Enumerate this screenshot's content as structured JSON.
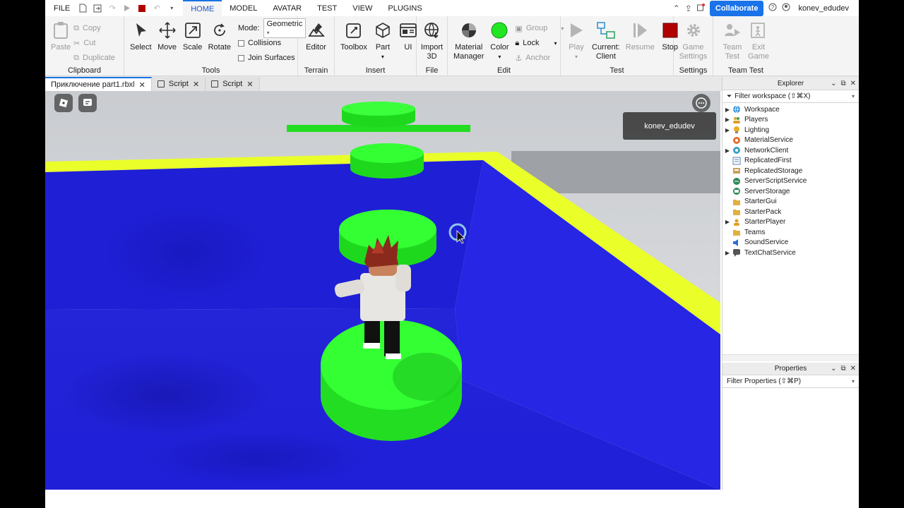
{
  "menubar": {
    "file": "FILE",
    "tabs": [
      "HOME",
      "MODEL",
      "AVATAR",
      "TEST",
      "VIEW",
      "PLUGINS"
    ],
    "collaborate": "Collaborate",
    "username": "konev_edudev"
  },
  "ribbon": {
    "clipboard": {
      "label": "Clipboard",
      "paste": "Paste",
      "copy": "Copy",
      "cut": "Cut",
      "duplicate": "Duplicate"
    },
    "tools": {
      "label": "Tools",
      "select": "Select",
      "move": "Move",
      "scale": "Scale",
      "rotate": "Rotate",
      "mode_label": "Mode:",
      "mode_value": "Geometric",
      "collisions": "Collisions",
      "join_surfaces": "Join Surfaces"
    },
    "terrain": {
      "label": "Terrain",
      "editor": "Editor"
    },
    "insert": {
      "label": "Insert",
      "toolbox": "Toolbox",
      "part": "Part",
      "ui": "UI"
    },
    "file": {
      "label": "File",
      "import_line1": "Import",
      "import_line2": "3D"
    },
    "edit": {
      "label": "Edit",
      "material_line1": "Material",
      "material_line2": "Manager",
      "color": "Color",
      "group": "Group",
      "lock": "Lock",
      "anchor": "Anchor"
    },
    "test": {
      "label": "Test",
      "play": "Play",
      "current_line1": "Current:",
      "current_line2": "Client",
      "resume": "Resume",
      "stop": "Stop"
    },
    "settings": {
      "label": "Settings",
      "game_line1": "Game",
      "game_line2": "Settings"
    },
    "team_test": {
      "label": "Team Test",
      "team_line1": "Team",
      "team_line2": "Test",
      "exit_line1": "Exit",
      "exit_line2": "Game"
    }
  },
  "doc_tabs": [
    {
      "label": "Приключение part1.rbxl"
    },
    {
      "label": "Script"
    },
    {
      "label": "Script"
    }
  ],
  "viewport": {
    "player_label": "konev_edudev"
  },
  "explorer": {
    "title": "Explorer",
    "filter": "Filter workspace (⇧⌘X)",
    "items": [
      {
        "label": "Workspace",
        "expandable": true,
        "icon": "globe-icon",
        "color": "#2f8fd8"
      },
      {
        "label": "Players",
        "expandable": true,
        "icon": "players-icon",
        "color": "#e0a020"
      },
      {
        "label": "Lighting",
        "expandable": true,
        "icon": "bulb-icon",
        "color": "#e8b020"
      },
      {
        "label": "MaterialService",
        "expandable": false,
        "icon": "material-icon",
        "color": "#e07030"
      },
      {
        "label": "NetworkClient",
        "expandable": true,
        "icon": "network-icon",
        "color": "#3aa0c8"
      },
      {
        "label": "ReplicatedFirst",
        "expandable": false,
        "icon": "replicated-first-icon",
        "color": "#5a7fb5"
      },
      {
        "label": "ReplicatedStorage",
        "expandable": false,
        "icon": "replicated-storage-icon",
        "color": "#c9a15a"
      },
      {
        "label": "ServerScriptService",
        "expandable": false,
        "icon": "server-script-icon",
        "color": "#2e8b57"
      },
      {
        "label": "ServerStorage",
        "expandable": false,
        "icon": "server-storage-icon",
        "color": "#2e8b57"
      },
      {
        "label": "StarterGui",
        "expandable": false,
        "icon": "folder-icon",
        "color": "#e0b040"
      },
      {
        "label": "StarterPack",
        "expandable": false,
        "icon": "folder-icon",
        "color": "#e0b040"
      },
      {
        "label": "StarterPlayer",
        "expandable": true,
        "icon": "starter-player-icon",
        "color": "#e0a020"
      },
      {
        "label": "Teams",
        "expandable": false,
        "icon": "folder-icon",
        "color": "#e0b040"
      },
      {
        "label": "SoundService",
        "expandable": false,
        "icon": "sound-icon",
        "color": "#2a6fd0"
      },
      {
        "label": "TextChatService",
        "expandable": true,
        "icon": "chat-icon",
        "color": "#555555"
      }
    ]
  },
  "properties": {
    "title": "Properties",
    "filter": "Filter Properties (⇧⌘P)"
  },
  "colors": {
    "accent": "#1a73e8",
    "floor": "#1f1fe0",
    "platform": "#22ee22",
    "rim": "#e8ff2a",
    "stop": "#b00000"
  }
}
